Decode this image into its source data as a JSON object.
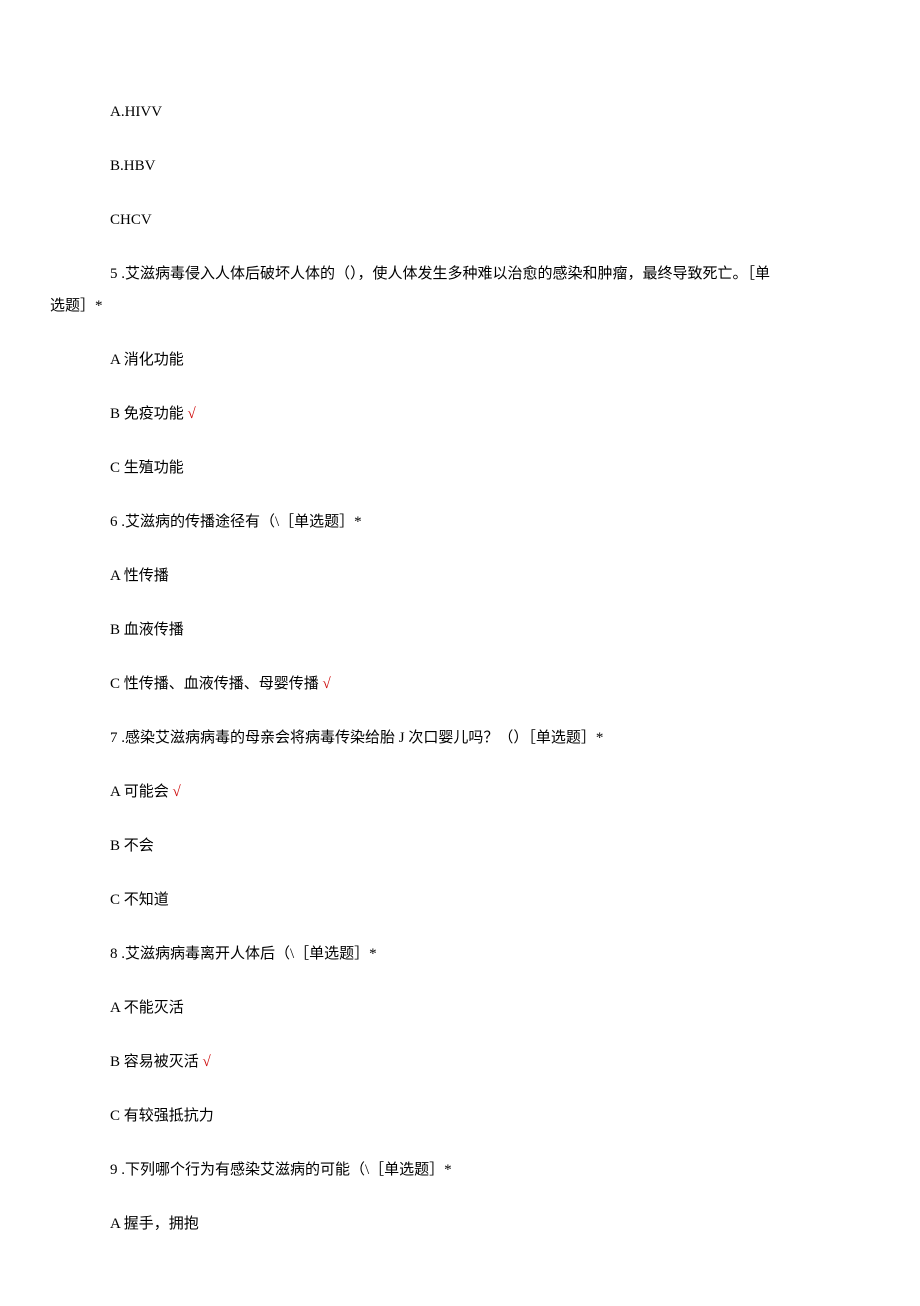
{
  "q4": {
    "optA": "A.HIVV",
    "optB": "B.HBV",
    "optC": "CHCV"
  },
  "q5": {
    "stem_part1": "5 .艾滋病毒侵入人体后破坏人体的（），使人体发生多种难以治愈的感染和肿瘤，最终导致死亡。［单",
    "stem_part2": "选题］*",
    "optA": "A 消化功能",
    "optB_text": "B 免疫功能 ",
    "optB_mark": "√",
    "optC": "C 生殖功能"
  },
  "q6": {
    "stem": "6 .艾滋病的传播途径有（\\［单选题］*",
    "optA": "A 性传播",
    "optB": "B 血液传播",
    "optC_text": "C 性传播、血液传播、母婴传播 ",
    "optC_mark": "√"
  },
  "q7": {
    "stem": "7 .感染艾滋病病毒的母亲会将病毒传染给胎 J 次口婴儿吗？（）［单选题］*",
    "optA_text": "A 可能会 ",
    "optA_mark": "√",
    "optB": "B 不会",
    "optC": "C 不知道"
  },
  "q8": {
    "stem": "8 .艾滋病病毒离开人体后（\\［单选题］*",
    "optA": "A 不能灭活",
    "optB_text": "B 容易被灭活 ",
    "optB_mark": "√",
    "optC": "C 有较强抵抗力"
  },
  "q9": {
    "stem": "9 .下列哪个行为有感染艾滋病的可能（\\［单选题］*",
    "optA": "A 握手，拥抱"
  }
}
